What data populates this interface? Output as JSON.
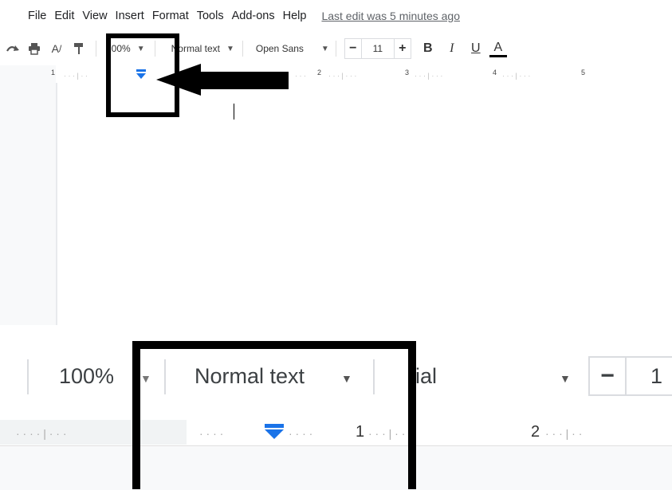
{
  "menu": {
    "items": [
      "File",
      "Edit",
      "View",
      "Insert",
      "Format",
      "Tools",
      "Add-ons",
      "Help"
    ],
    "last_edit": "Last edit was 5 minutes ago"
  },
  "toolbar_top": {
    "zoom": "100%",
    "style": "Normal text",
    "font": "Open Sans",
    "font_size": "11",
    "minus": "−",
    "plus": "+",
    "bold": "B",
    "italic": "I",
    "underline": "U",
    "text_color": "A"
  },
  "ruler_top": {
    "numbers": [
      "1",
      "2",
      "3",
      "4",
      "5"
    ]
  },
  "toolbar_bottom": {
    "zoom": "100%",
    "style": "Normal text",
    "font_partial": "rial",
    "minus": "−",
    "size_partial": "1"
  },
  "ruler_bottom": {
    "numbers": [
      "1",
      "2"
    ]
  },
  "colors": {
    "accent": "#1a73e8",
    "highlight": "#000000"
  }
}
